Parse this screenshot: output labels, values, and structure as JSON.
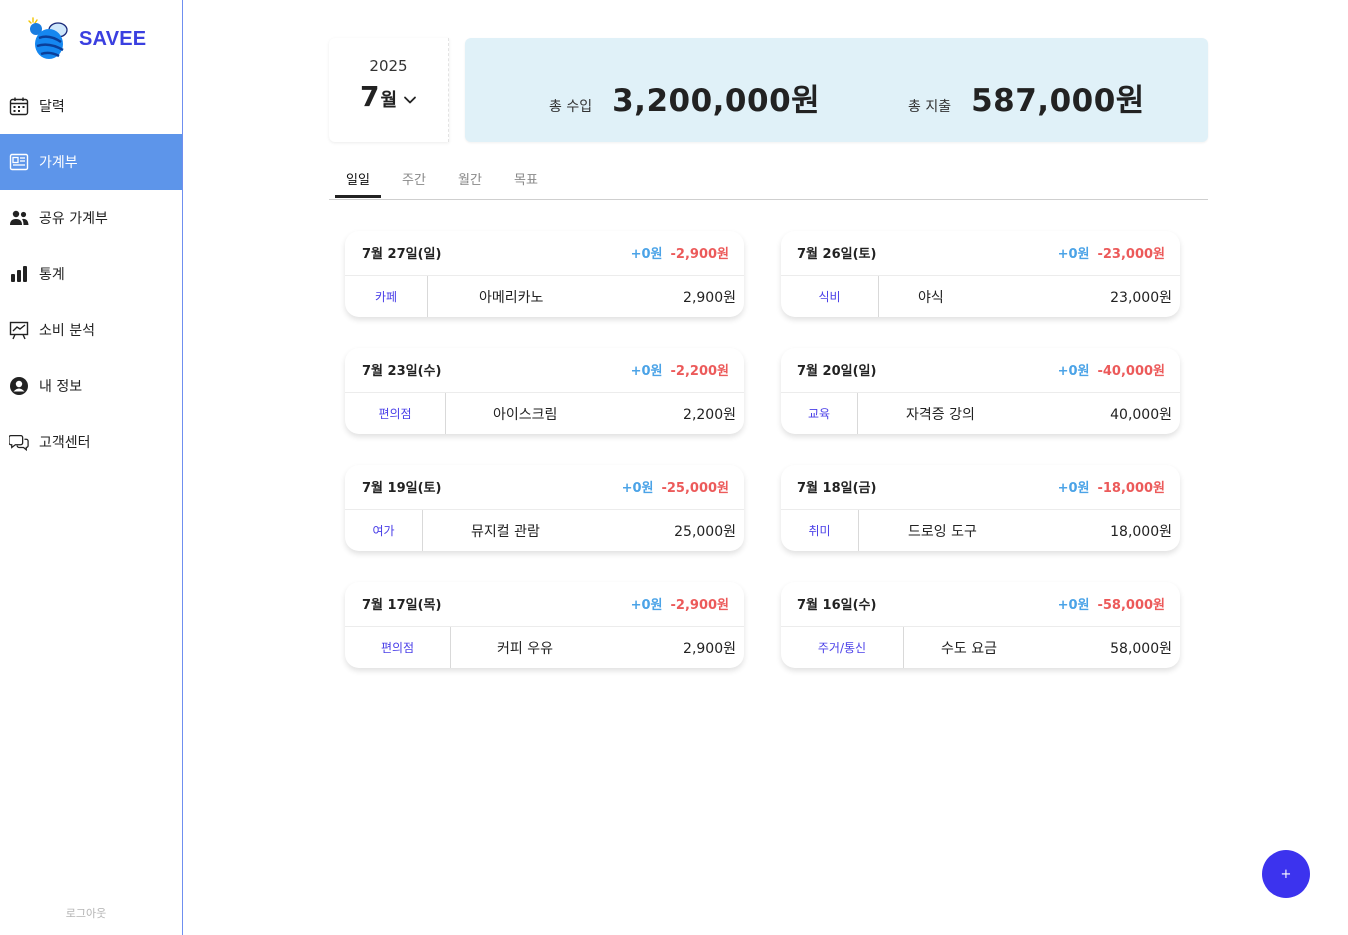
{
  "app": {
    "name": "SAVEE",
    "logo_icon": "bee-logo-icon"
  },
  "sidebar": {
    "items": [
      {
        "label": "달력",
        "icon": "calendar-icon"
      },
      {
        "label": "가계부",
        "icon": "ledger-icon",
        "active": true
      },
      {
        "label": "공유 가계부",
        "icon": "users-icon"
      },
      {
        "label": "통계",
        "icon": "bar-chart-icon"
      },
      {
        "label": "소비 분석",
        "icon": "analysis-icon"
      },
      {
        "label": "내 정보",
        "icon": "user-circle-icon"
      },
      {
        "label": "고객센터",
        "icon": "chat-bubbles-icon"
      }
    ],
    "logout_label": "로그아웃"
  },
  "header": {
    "year": "2025",
    "month": "7",
    "month_unit": "월",
    "income_label": "총 수입",
    "income_value": "3,200,000원",
    "expense_label": "총 지출",
    "expense_value": "587,000원"
  },
  "tabs": [
    {
      "label": "일일",
      "active": true
    },
    {
      "label": "주간"
    },
    {
      "label": "월간"
    },
    {
      "label": "목표"
    }
  ],
  "cards": [
    {
      "date": "7월 27일(일)",
      "income": "+0원",
      "expense": "-2,900원",
      "category": "카페",
      "item": "아메리카노",
      "amount": "2,900원"
    },
    {
      "date": "7월 26일(토)",
      "income": "+0원",
      "expense": "-23,000원",
      "category": "식비",
      "item": "야식",
      "amount": "23,000원"
    },
    {
      "date": "7월 23일(수)",
      "income": "+0원",
      "expense": "-2,200원",
      "category": "편의점",
      "item": "아이스크림",
      "amount": "2,200원"
    },
    {
      "date": "7월 20일(일)",
      "income": "+0원",
      "expense": "-40,000원",
      "category": "교육",
      "item": "자격증 강의",
      "amount": "40,000원"
    },
    {
      "date": "7월 19일(토)",
      "income": "+0원",
      "expense": "-25,000원",
      "category": "여가",
      "item": "뮤지컬 관람",
      "amount": "25,000원"
    },
    {
      "date": "7월 18일(금)",
      "income": "+0원",
      "expense": "-18,000원",
      "category": "취미",
      "item": "드로잉 도구",
      "amount": "18,000원"
    },
    {
      "date": "7월 17일(목)",
      "income": "+0원",
      "expense": "-2,900원",
      "category": "편의점",
      "item": "커피 우유",
      "amount": "2,900원"
    },
    {
      "date": "7월 16일(수)",
      "income": "+0원",
      "expense": "-58,000원",
      "category": "주거/통신",
      "item": "수도 요금",
      "amount": "58,000원"
    }
  ],
  "fab": {
    "label": "+"
  },
  "colors": {
    "accent": "#3c33ee",
    "active_nav": "#5d95ea",
    "income": "#4ba3e7",
    "expense": "#ec5a5a",
    "summary_bg": "#e0f1f8"
  }
}
